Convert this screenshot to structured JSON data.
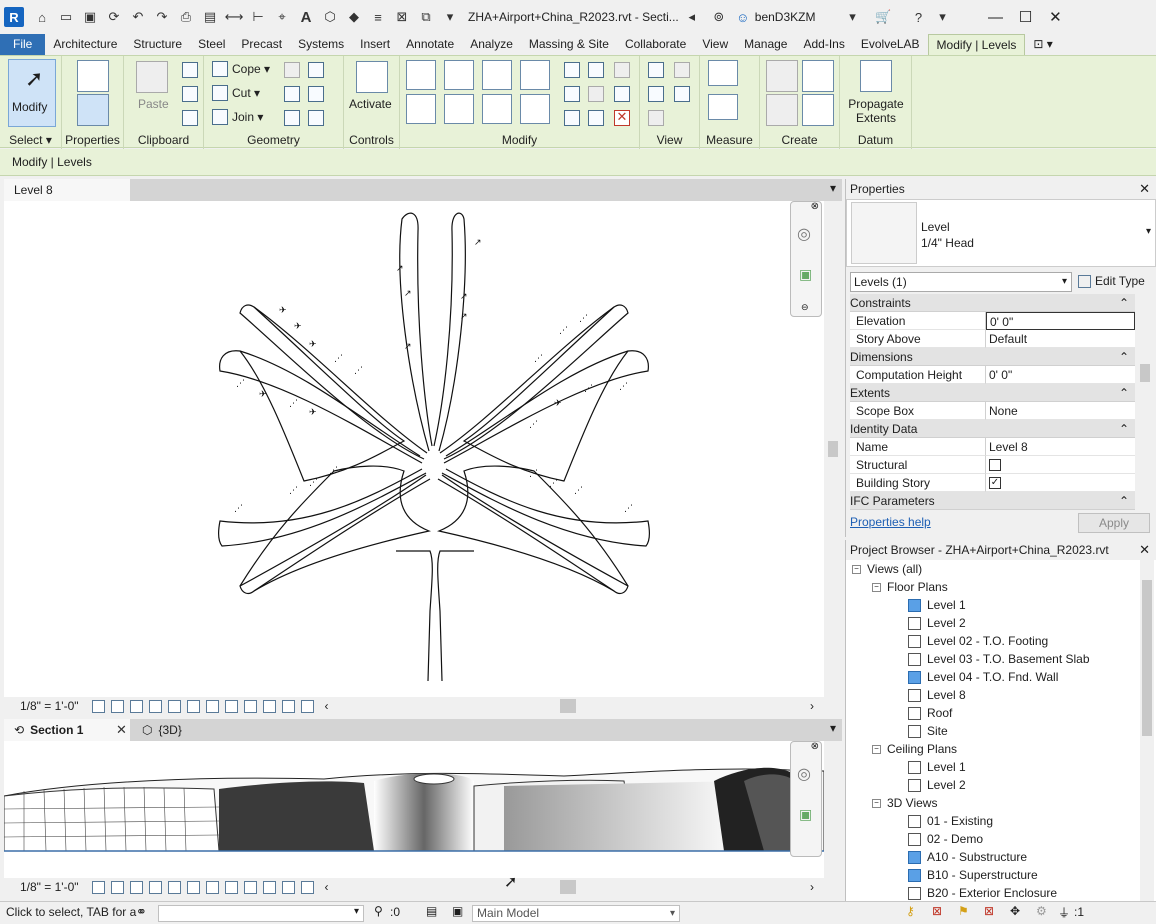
{
  "titlebar": {
    "app_logo": "R",
    "document_title": "ZHA+Airport+China_R2023.rvt - Secti...",
    "user_name": "benD3KZM",
    "quick_access_icons": [
      "open-icon",
      "save-icon",
      "sync-icon",
      "undo-icon",
      "redo-icon",
      "print-icon",
      "measure-icon",
      "text-icon",
      "3d-icon",
      "section-icon"
    ]
  },
  "ribbon_tabs": [
    "File",
    "Architecture",
    "Structure",
    "Steel",
    "Precast",
    "Systems",
    "Insert",
    "Annotate",
    "Analyze",
    "Massing & Site",
    "Collaborate",
    "View",
    "Manage",
    "Add-Ins",
    "EvolveLAB",
    "Modify | Levels"
  ],
  "ribbon": {
    "modify_label": "Modify",
    "select_label": "Select",
    "properties_label": "Properties",
    "clipboard_label": "Clipboard",
    "paste_label": "Paste",
    "cope_label": "Cope",
    "cut_label": "Cut",
    "join_label": "Join",
    "geometry_label": "Geometry",
    "activate_label": "Activate",
    "controls_label": "Controls",
    "modify_panel_label": "Modify",
    "view_label": "View",
    "measure_label": "Measure",
    "create_label": "Create",
    "propagate_label_1": "Propagate",
    "propagate_label_2": "Extents",
    "datum_label": "Datum"
  },
  "context_bar": "Modify | Levels",
  "plan_view": {
    "tab_label": "Level 8",
    "scale": "1/8\" = 1'-0\""
  },
  "section_view": {
    "tab_label": "Section 1",
    "other_tab_label": "{3D}",
    "scale": "1/8\" = 1'-0\""
  },
  "properties": {
    "title": "Properties",
    "type_name_1": "Level",
    "type_name_2": "1/4\" Head",
    "selector": "Levels (1)",
    "edit_type": "Edit Type",
    "groups": {
      "constraints": "Constraints",
      "dimensions": "Dimensions",
      "extents": "Extents",
      "identity": "Identity Data",
      "ifc": "IFC Parameters"
    },
    "rows": {
      "elevation_k": "Elevation",
      "elevation_v": "0'  0\"",
      "story_above_k": "Story Above",
      "story_above_v": "Default",
      "comp_height_k": "Computation Height",
      "comp_height_v": "0'  0\"",
      "scope_box_k": "Scope Box",
      "scope_box_v": "None",
      "name_k": "Name",
      "name_v": "Level 8",
      "structural_k": "Structural",
      "building_story_k": "Building Story"
    },
    "help_link": "Properties help",
    "apply": "Apply"
  },
  "browser": {
    "title": "Project Browser - ZHA+Airport+China_R2023.rvt",
    "views_all": "Views (all)",
    "floor_plans": "Floor Plans",
    "floor_plan_items": [
      "Level 1",
      "Level 2",
      "Level 02 - T.O. Footing",
      "Level 03 - T.O. Basement Slab",
      "Level 04 - T.O. Fnd. Wall",
      "Level 8",
      "Roof",
      "Site"
    ],
    "ceiling_plans": "Ceiling Plans",
    "ceiling_plan_items": [
      "Level 1",
      "Level 2"
    ],
    "views_3d": "3D Views",
    "views_3d_items": [
      "01 - Existing",
      "02 - Demo",
      "A10 - Substructure",
      "B10 - Superstructure",
      "B20 - Exterior Enclosure"
    ]
  },
  "statusbar": {
    "hint": "Click to select, TAB for a",
    "count": ":0",
    "model": "Main Model",
    "filter_count": ":1"
  }
}
